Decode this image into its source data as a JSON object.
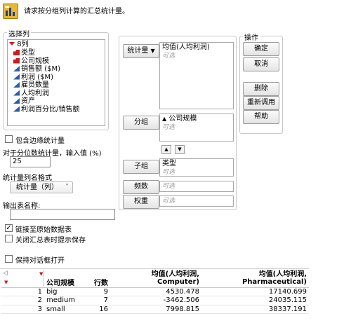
{
  "header": {
    "instruction": "请求按分组列计算的汇总统计量。"
  },
  "select_columns": {
    "legend": "选择列",
    "count_label": "8列",
    "columns": [
      {
        "label": "类型",
        "type": "categorical"
      },
      {
        "label": "公司规模",
        "type": "categorical"
      },
      {
        "label": "销售额 ($M)",
        "type": "continuous"
      },
      {
        "label": "利润 ($M)",
        "type": "continuous"
      },
      {
        "label": "雇员数量",
        "type": "continuous"
      },
      {
        "label": "人均利润",
        "type": "continuous"
      },
      {
        "label": "资产",
        "type": "continuous"
      },
      {
        "label": "利润百分比/销售额",
        "type": "continuous"
      }
    ]
  },
  "options": {
    "include_marginal": "包含边缘统计量",
    "quantile_label": "对于分位数统计量，输入值 (%)",
    "quantile_value": "25",
    "name_format_label": "统计量列名格式",
    "name_format_value": "统计量（列）",
    "output_name_label": "输出表名称:",
    "output_name_value": "",
    "link_to_original": "链接至原始数据表",
    "link_checked": true,
    "prompt_save": "关闭汇总表时提示保存",
    "prompt_checked": false,
    "keep_open": "保持对话框打开",
    "keep_checked": false
  },
  "roles": {
    "statistics_button": "统计量",
    "statistics_value": "均值(人均利润)",
    "group_button": "分组",
    "group_value": "公司规模",
    "subgroup_button": "子组",
    "subgroup_value": "类型",
    "freq_button": "频数",
    "weight_button": "权重",
    "optional": "可选"
  },
  "actions": {
    "legend": "操作",
    "ok": "确定",
    "cancel": "取消",
    "remove": "删除",
    "recall": "重新调用",
    "help": "帮助"
  },
  "result_table": {
    "headers": [
      "公司规模",
      "行数",
      "均值(人均利润,\nComputer)",
      "均值(人均利润,\nPharmaceutical)"
    ],
    "rows": [
      {
        "index": "1",
        "size": "big",
        "n": "9",
        "computer": "4530.478",
        "pharma": "17140.699"
      },
      {
        "index": "2",
        "size": "medium",
        "n": "7",
        "computer": "-3462.506",
        "pharma": "24035.115"
      },
      {
        "index": "3",
        "size": "small",
        "n": "16",
        "computer": "7998.815",
        "pharma": "38337.191"
      }
    ]
  }
}
